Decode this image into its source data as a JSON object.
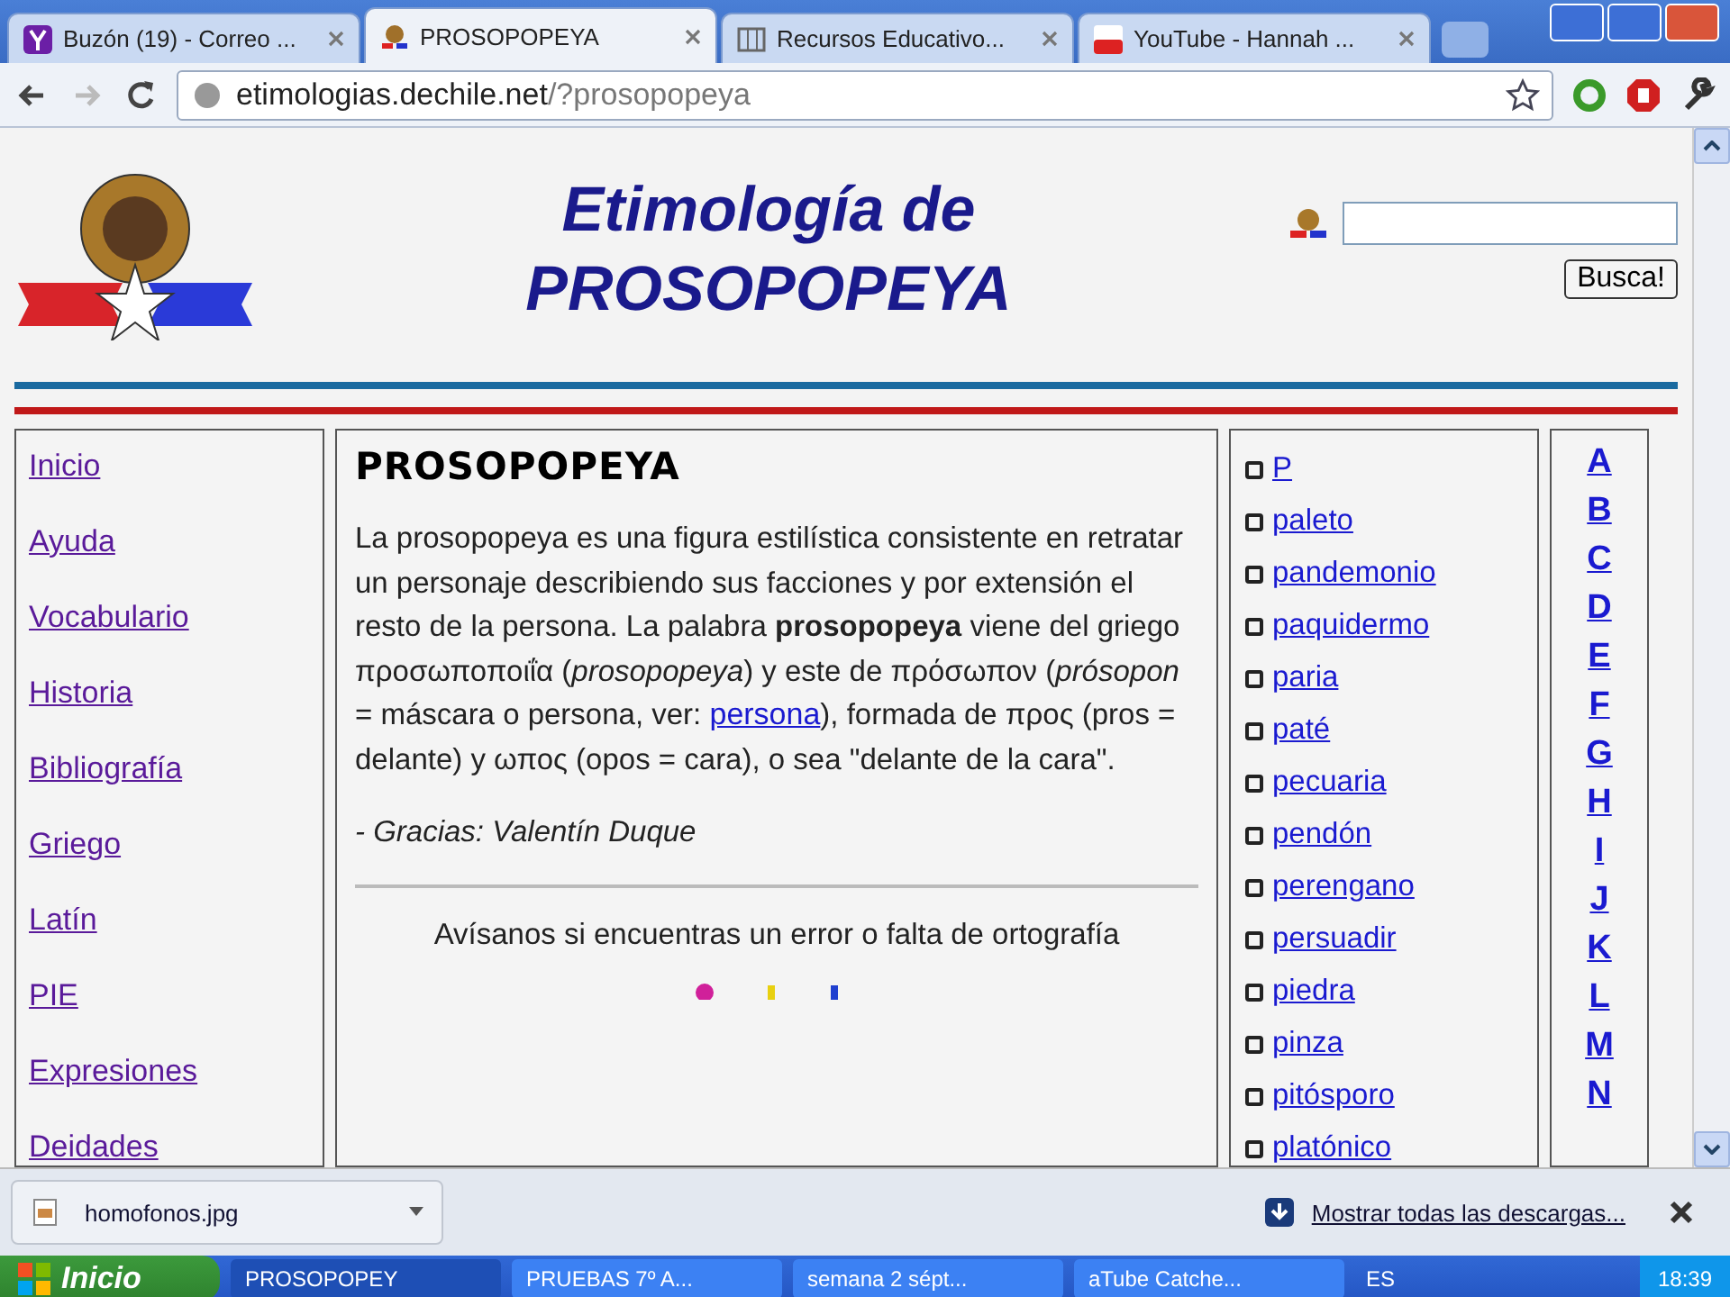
{
  "tabs": [
    {
      "label": "Buzón (19) - Correo ...",
      "selected": false
    },
    {
      "label": "PROSOPOPEYA",
      "selected": true
    },
    {
      "label": "Recursos Educativo...",
      "selected": false
    },
    {
      "label": "YouTube - Hannah ...",
      "selected": false
    }
  ],
  "address_bar": {
    "host": "etimologias.dechile.net",
    "path": "/?prosopopeya"
  },
  "header": {
    "title_line_1": "Etimología de",
    "title_line_2": "PROSOPOPEYA",
    "search_button": "Busca!"
  },
  "nav": [
    "Inicio",
    "Ayuda",
    "Vocabulario",
    "Historia",
    "Bibliografía",
    "Griego",
    "Latín",
    "PIE",
    "Expresiones",
    "Deidades"
  ],
  "article": {
    "heading": "PROSOPOPEYA",
    "text_before_link": "La prosopopeya es una figura estilística consistente en retratar un personaje describiendo sus facciones y por extensión el resto de la persona. La palabra **prosopopeya** viene del griego προσωποποιΐα (*prosopopeya*) y este de πρόσωπον (*prósopon* = máscara o persona, ver: ",
    "link": "persona",
    "text_after_link": "), formada de προς (pros = delante) y ωπος (opos = cara), o sea \"delante de la cara\".",
    "credit": "- Gracias: Valentín Duque",
    "report": "Avísanos si encuentras un error o falta de ortografía"
  },
  "words": [
    "P",
    "paleto",
    "pandemonio",
    "paquidermo",
    "paria",
    "paté",
    "pecuaria",
    "pendón",
    "perengano",
    "persuadir",
    "piedra",
    "pinza",
    "pitósporo",
    "platónico"
  ],
  "letters": [
    "A",
    "B",
    "C",
    "D",
    "E",
    "F",
    "G",
    "H",
    "I",
    "J",
    "K",
    "L",
    "M",
    "N"
  ],
  "download_bar": {
    "file": "homofonos.jpg",
    "show_all": "Mostrar todas las descargas..."
  },
  "taskbar": {
    "start": "Inicio",
    "items": [
      {
        "label": "PROSOPOPEY",
        "selected": true
      },
      {
        "label": "PRUEBAS 7º A...",
        "selected": false
      },
      {
        "label": "semana 2 sépt...",
        "selected": false
      },
      {
        "label": "aTube Catche...",
        "selected": false
      }
    ],
    "language": "ES",
    "time": "18:39"
  }
}
